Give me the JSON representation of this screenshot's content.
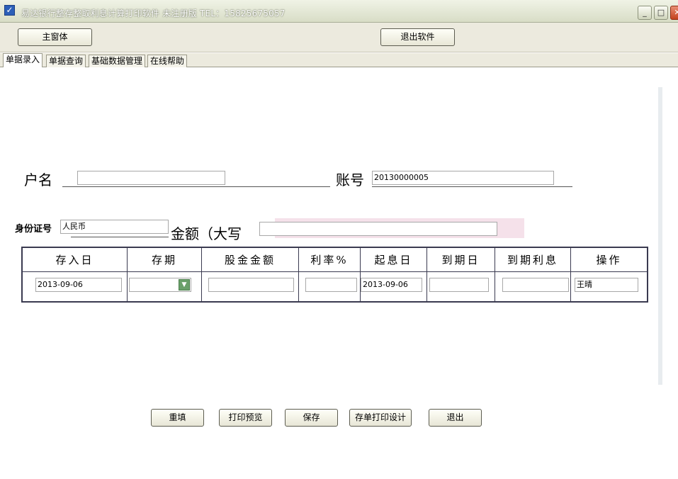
{
  "window": {
    "title": "易达银行整存整取利息计算打印软件 未注册版  TEL：15825675057",
    "min_glyph": "_",
    "max_glyph": "□",
    "close_glyph": "✕"
  },
  "toolbar": {
    "main_window_label": "主窗体",
    "exit_software_label": "退出软件"
  },
  "tabs": [
    {
      "label": "单据录入",
      "active": true
    },
    {
      "label": "单据查询",
      "active": false
    },
    {
      "label": "基础数据管理",
      "active": false
    },
    {
      "label": "在线帮助",
      "active": false
    }
  ],
  "form": {
    "account_name_label": "户名",
    "account_name_value": "",
    "account_no_label": "账号",
    "account_no_value": "20130000005",
    "id_label": "身份证号",
    "id_value": "人民币",
    "amount_label": "金额（大写",
    "amount_value": ""
  },
  "grid": {
    "headers": [
      "存入日",
      "存期",
      "股金金额",
      "利率%",
      "起息日",
      "到期日",
      "到期利息",
      "操作"
    ],
    "row": {
      "deposit_date": "2013-09-06",
      "term": "",
      "amount": "",
      "rate": "",
      "interest_start": "2013-09-06",
      "maturity": "",
      "maturity_interest": "",
      "operator": "王晴"
    }
  },
  "buttons": {
    "reset": "重填",
    "print_preview": "打印预览",
    "save": "保存",
    "print_design": "存单打印设计",
    "exit": "退出"
  },
  "colors": {
    "titlebar": "#d8ddc6",
    "toolbar": "#eceade",
    "grid_border": "#3a3a50",
    "amount_highlight": "#f5e1ea"
  }
}
